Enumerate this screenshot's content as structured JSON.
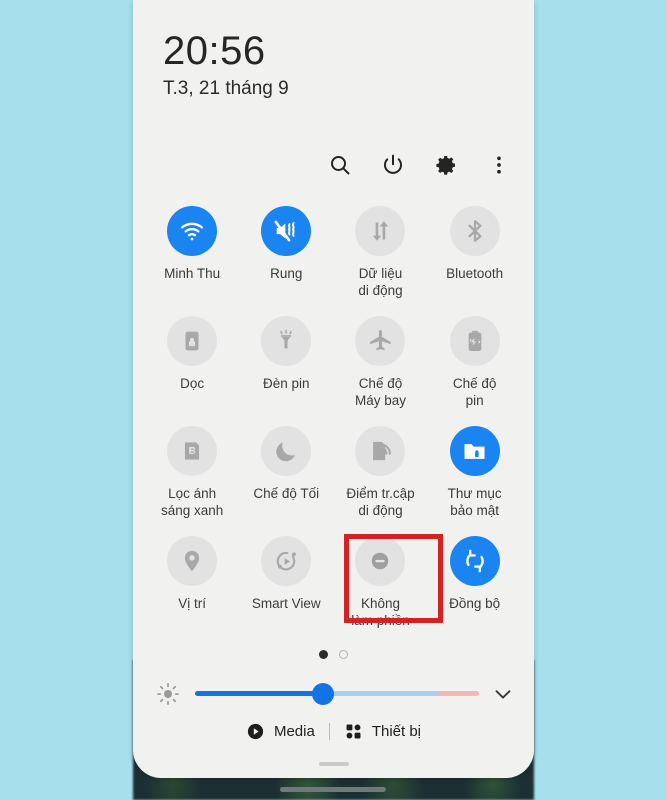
{
  "colors": {
    "background": "#a7dfec",
    "panel": "#f1f1f0",
    "accent_active": "#1a84f0",
    "tile_inactive": "#e2e2e2",
    "highlight_box": "#d42222",
    "slider_fill": "#1273e6",
    "slider_track": "#a9cef3",
    "slider_warm": "#f3b7b6"
  },
  "clock": {
    "time": "20:56",
    "date": "T.3, 21 tháng 9"
  },
  "header": {
    "icons": [
      {
        "name": "search-icon",
        "label": "Tìm kiếm"
      },
      {
        "name": "power-icon",
        "label": "Nguồn"
      },
      {
        "name": "gear-icon",
        "label": "Cài đặt"
      },
      {
        "name": "more-vertical-icon",
        "label": "Thêm"
      }
    ]
  },
  "toggles": [
    {
      "label": "Minh Thu",
      "icon": "wifi-icon",
      "state": "active"
    },
    {
      "label": "Rung",
      "icon": "vibrate-icon",
      "state": "active"
    },
    {
      "label": "Dữ liệu\ndi động",
      "icon": "mobile-data-icon",
      "state": "inactive"
    },
    {
      "label": "Bluetooth",
      "icon": "bluetooth-icon",
      "state": "inactive"
    },
    {
      "label": "Dọc",
      "icon": "rotation-lock-icon",
      "state": "inactive"
    },
    {
      "label": "Đèn pin",
      "icon": "flashlight-icon",
      "state": "inactive"
    },
    {
      "label": "Chế độ\nMáy bay",
      "icon": "airplane-icon",
      "state": "inactive"
    },
    {
      "label": "Chế độ\npin",
      "icon": "power-saving-icon",
      "state": "inactive"
    },
    {
      "label": "Lọc ánh\nsáng xanh",
      "icon": "blue-light-filter-icon",
      "state": "inactive"
    },
    {
      "label": "Chế độ Tối",
      "icon": "dark-mode-icon",
      "state": "inactive"
    },
    {
      "label": "Điểm tr.cập\ndi động",
      "icon": "hotspot-icon",
      "state": "inactive"
    },
    {
      "label": "Thư mục\nbảo mật",
      "icon": "secure-folder-icon",
      "state": "active"
    },
    {
      "label": "Vị trí",
      "icon": "location-pin-icon",
      "state": "inactive"
    },
    {
      "label": "Smart View",
      "icon": "smart-view-icon",
      "state": "inactive"
    },
    {
      "label": "Không\nlàm phiền",
      "icon": "do-not-disturb-icon",
      "state": "inactive",
      "highlighted": true
    },
    {
      "label": "Đồng bộ",
      "icon": "sync-icon",
      "state": "active"
    }
  ],
  "pager": {
    "total": 2,
    "current": 1
  },
  "brightness": {
    "icon": "brightness-sun-icon",
    "value_percent": 45,
    "warm_segment_percent": 14.5,
    "expand_icon": "chevron-down-icon"
  },
  "bottom_bar": {
    "media": {
      "label": "Media",
      "icon": "play-circle-icon"
    },
    "devices": {
      "label": "Thiết bị",
      "icon": "grid-squares-icon"
    }
  }
}
